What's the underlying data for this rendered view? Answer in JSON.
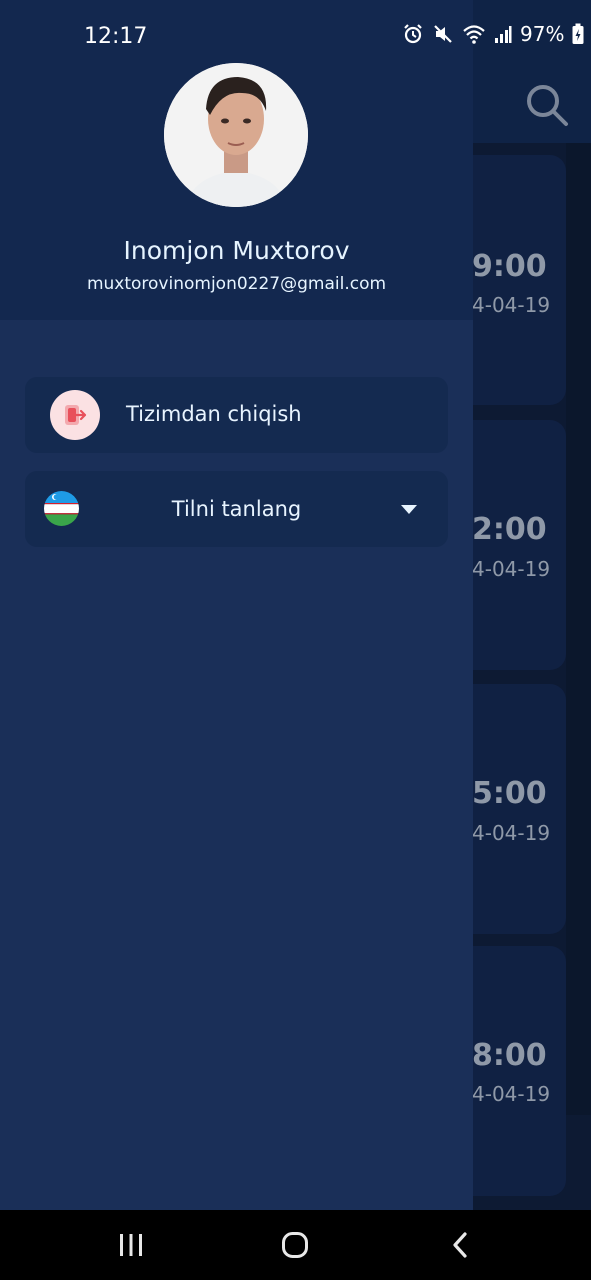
{
  "status_bar": {
    "time": "12:17",
    "battery": "97%"
  },
  "profile": {
    "name": "Inomjon Muxtorov",
    "email": "muxtorovinomjon0227@gmail.com"
  },
  "menu": {
    "logout_label": "Tizimdan chiqish",
    "language_label": "Tilni tanlang"
  },
  "background_cards": [
    {
      "time": "9:00",
      "date": "4-04-19"
    },
    {
      "time": "2:00",
      "date": "4-04-19"
    },
    {
      "time": "5:00",
      "date": "4-04-19"
    },
    {
      "time": "8:00",
      "date": "4-04-19"
    }
  ],
  "colors": {
    "drawer_bg": "#1a2f58",
    "drawer_header_bg": "#13284f",
    "menu_item_bg": "#142a50",
    "accent_text": "#e6f4ff",
    "logout_icon_bg": "#fbe1e3",
    "logout_icon": "#e8505b"
  },
  "icons": {
    "logout": "logout-icon",
    "flag": "uzbekistan-flag-icon",
    "dropdown": "caret-down-icon",
    "search": "search-icon"
  }
}
